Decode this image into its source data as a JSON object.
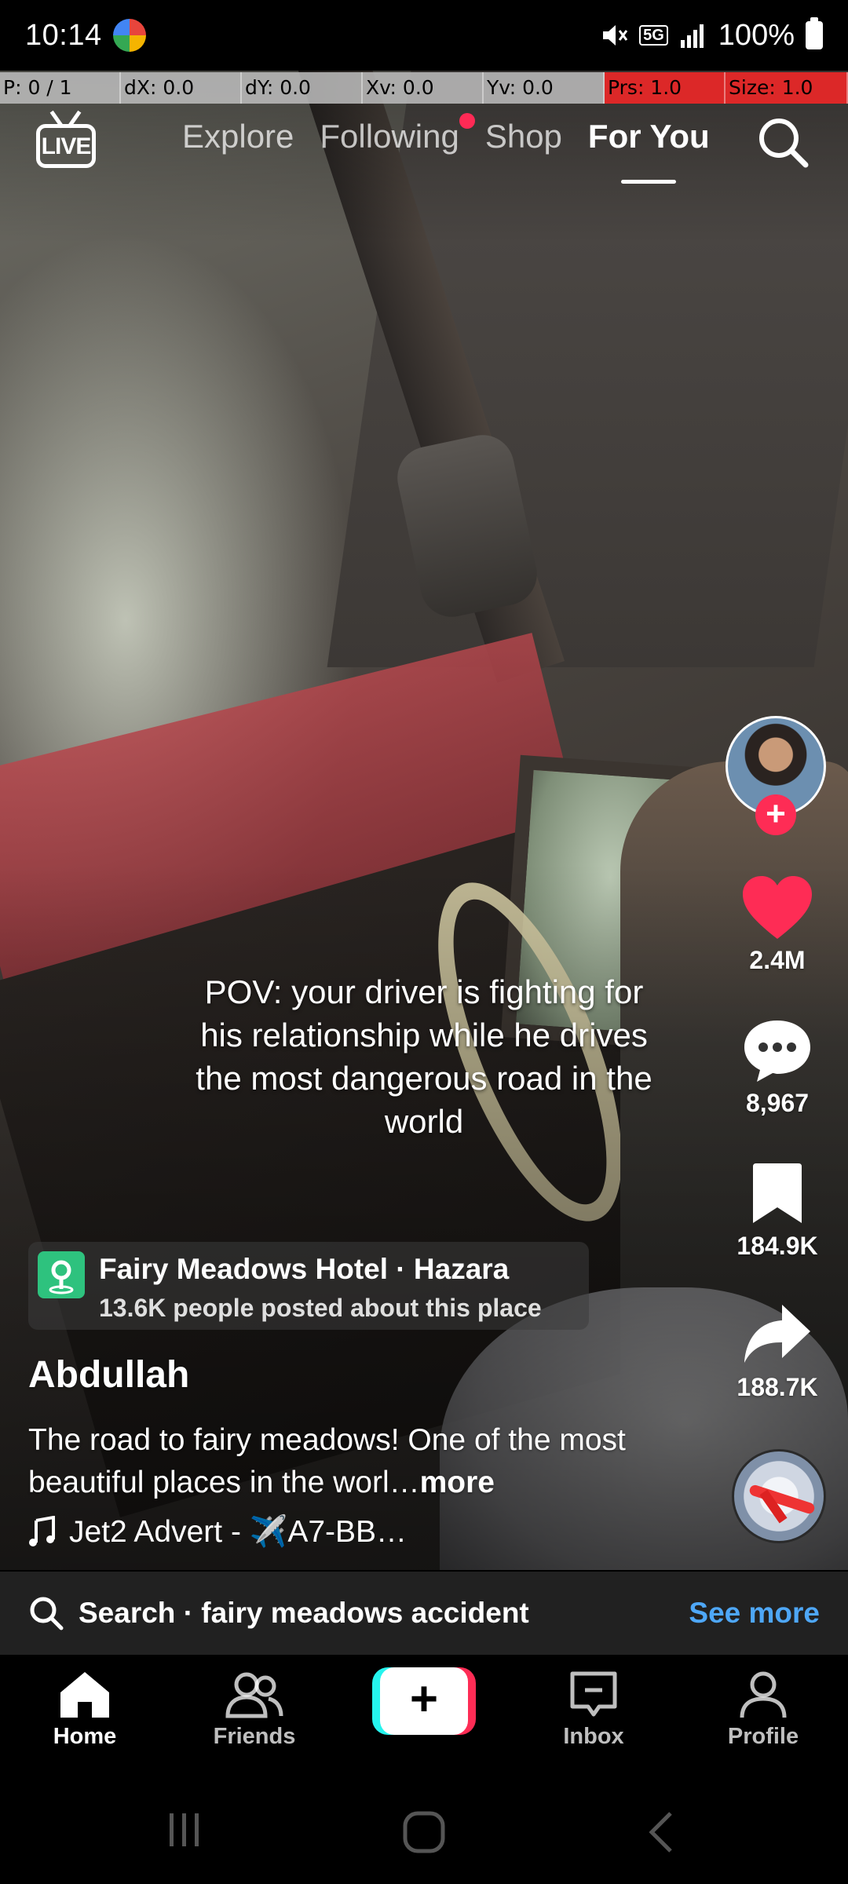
{
  "status_bar": {
    "time": "10:14",
    "network": "5G",
    "battery": "100%"
  },
  "debug_bar": {
    "p": "P: 0 / 1",
    "dx": "dX: 0.0",
    "dy": "dY: 0.0",
    "xv": "Xv: 0.0",
    "yv": "Yv: 0.0",
    "prs": "Prs: 1.0",
    "size": "Size: 1.0"
  },
  "top_nav": {
    "live_label": "LIVE",
    "tabs": [
      {
        "label": "Explore"
      },
      {
        "label": "Following"
      },
      {
        "label": "Shop"
      },
      {
        "label": "For You"
      }
    ],
    "active_tab": "For You"
  },
  "video": {
    "overlay_text": "POV: your driver is fighting for his relationship while he drives the most dangerous road in the world"
  },
  "actions": {
    "likes": "2.4M",
    "comments": "8,967",
    "saves": "184.9K",
    "shares": "188.7K",
    "follow_plus": "+"
  },
  "location": {
    "title": "Fairy Meadows Hotel · Hazara",
    "subtitle": "13.6K people posted about this place"
  },
  "post": {
    "author": "Abdullah",
    "caption": "The road to fairy meadows! One of the most beautiful places in the worl…",
    "more_label": "more",
    "sound": "Jet2 Advert - ✈️A7-BB…"
  },
  "search_suggestion": {
    "text": "Search · fairy meadows accident",
    "see_more": "See more"
  },
  "bottom_nav": {
    "items": [
      {
        "label": "Home"
      },
      {
        "label": "Friends"
      },
      {
        "label": "Inbox"
      },
      {
        "label": "Profile"
      }
    ],
    "create_label": "+"
  },
  "colors": {
    "accent_red": "#fe2c55",
    "accent_cyan": "#25f4ee",
    "link_blue": "#4ea7f7",
    "location_green": "#2ec27e"
  },
  "icons": [
    "live-icon",
    "search-icon",
    "heart-icon",
    "comment-icon",
    "bookmark-icon",
    "share-icon",
    "music-note-icon",
    "location-pin-icon",
    "home-icon",
    "friends-icon",
    "inbox-icon",
    "profile-icon"
  ]
}
